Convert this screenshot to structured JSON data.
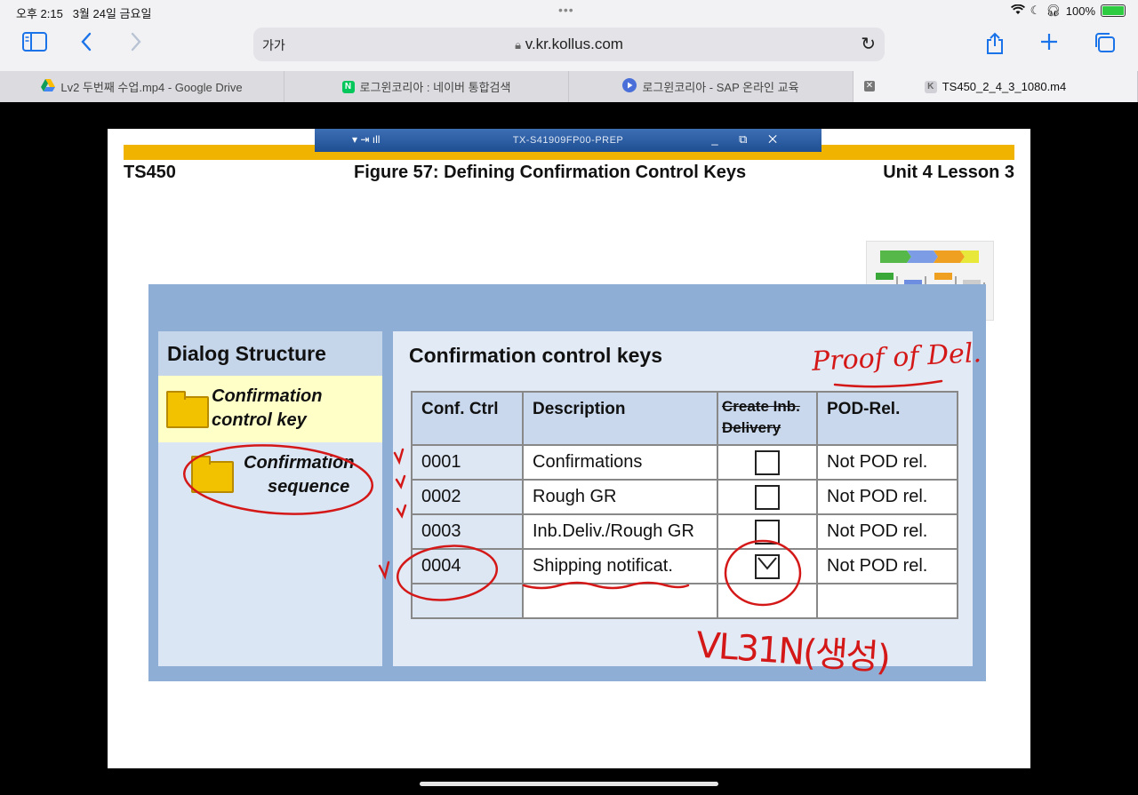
{
  "status": {
    "time": "오후 2:15",
    "date": "3월 24일 금요일",
    "battery": "100%"
  },
  "browser": {
    "text_size_label": "가가",
    "url": "v.kr.kollus.com",
    "tabs": [
      {
        "label": "Lv2 두번째 수업.mp4 - Google Drive",
        "icon": "google-drive-icon"
      },
      {
        "label": "로그윈코리아 : 네이버 통합검색",
        "icon": "naver-icon"
      },
      {
        "label": "로그윈코리아 - SAP 온라인 교육",
        "icon": "play-icon"
      },
      {
        "label": "TS450_2_4_3_1080.m4",
        "icon": "kollus-icon",
        "active": true
      }
    ]
  },
  "slide": {
    "sap_window_title": "TX-S41909FP00-PREP",
    "course": "TS450",
    "figure_title": "Figure 57: Defining Confirmation Control Keys",
    "unit": "Unit 4 Lesson 3",
    "dialog_structure": {
      "title": "Dialog Structure",
      "items": [
        {
          "label_line1": "Confirmation",
          "label_line2": "control key",
          "selected": true
        },
        {
          "label_line1": "Confirmation",
          "label_line2": "sequence",
          "selected": false
        }
      ]
    },
    "table": {
      "title": "Confirmation control keys",
      "headers": {
        "key": "Conf. Ctrl",
        "desc": "Description",
        "chk_line1": "Create Inb.",
        "chk_line2": "Delivery",
        "pod": "POD-Rel."
      },
      "rows": [
        {
          "key": "0001",
          "desc": "Confirmations",
          "checked": false,
          "pod": "Not POD rel."
        },
        {
          "key": "0002",
          "desc": "Rough GR",
          "checked": false,
          "pod": "Not POD rel."
        },
        {
          "key": "0003",
          "desc": "Inb.Deliv./Rough GR",
          "checked": false,
          "pod": "Not POD rel."
        },
        {
          "key": "0004",
          "desc": "Shipping notificat.",
          "checked": true,
          "pod": "Not POD rel."
        }
      ]
    },
    "annotations": {
      "top_right": "Proof of Del.",
      "bottom": "VL31N(생성)"
    }
  }
}
